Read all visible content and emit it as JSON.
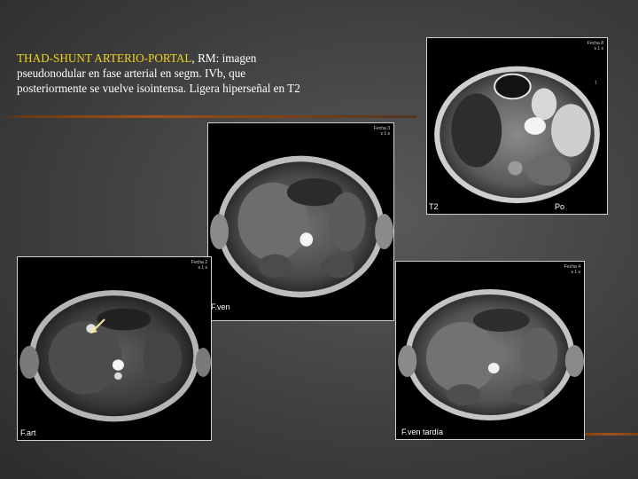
{
  "caption": {
    "highlight": "THAD-SHUNT ARTERIO-PORTAL",
    "rest": ", RM: imagen pseudonodular en fase arterial en segm. IVb, que posteriormente se vuelve isointensa. Ligera hiperseñal en  T2"
  },
  "panels": {
    "t2": {
      "label": "T2",
      "po_label": "Po",
      "corner_line1": "Fecha 8",
      "corner_line2": "s 1 s",
      "side_tag": "I"
    },
    "fven": {
      "label": "F.ven",
      "corner_line1": "Fecha 3",
      "corner_line2": "s 1 s"
    },
    "fart": {
      "label": "F.art",
      "corner_line1": "Fecha 2",
      "corner_line2": "s 1 s"
    },
    "fven_tardia": {
      "label": "F.ven tardía",
      "corner_line1": "Fecha 4",
      "corner_line2": "s 1 s"
    }
  },
  "colors": {
    "highlight": "#f2d21a",
    "rule": "#a0521a",
    "arrow": "#f5e9a0"
  }
}
